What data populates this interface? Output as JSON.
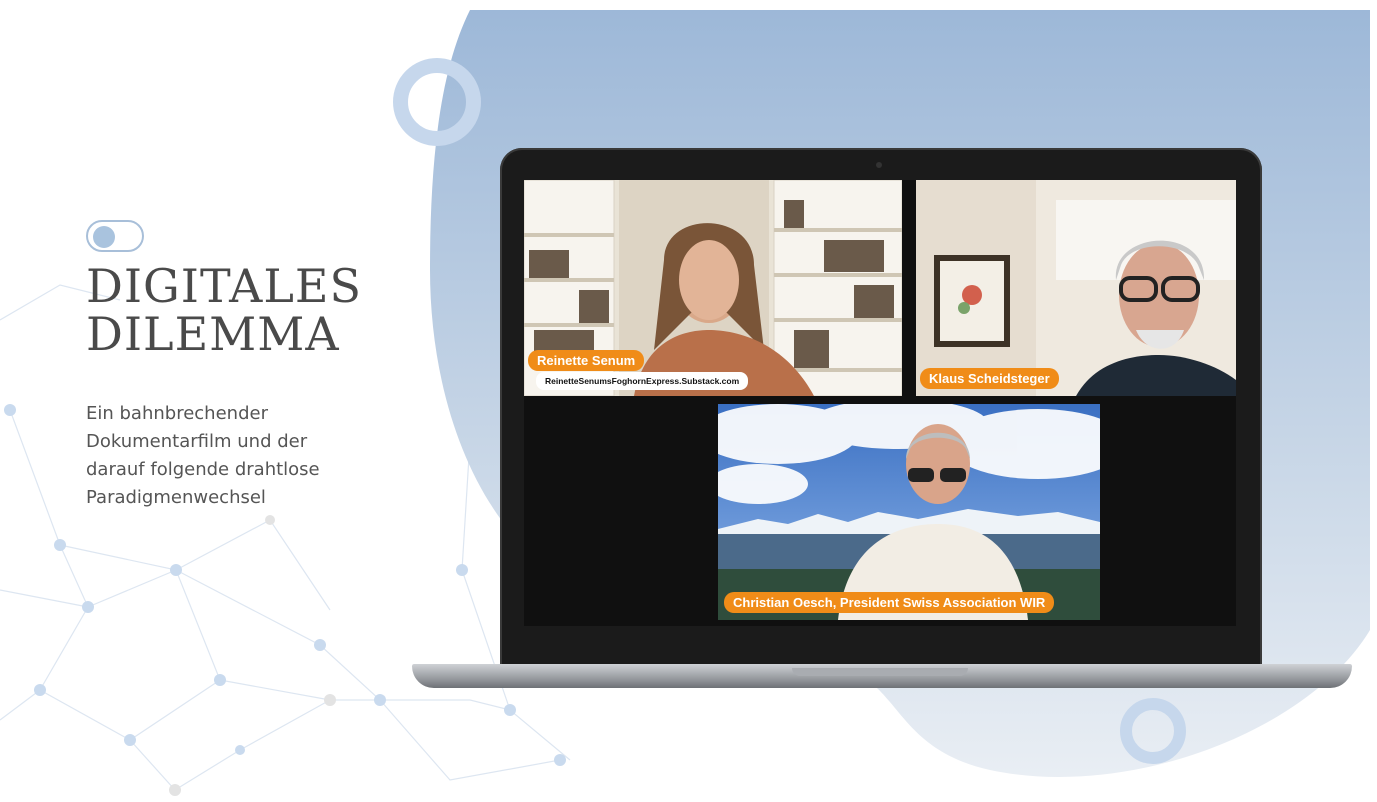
{
  "slide": {
    "title_line1": "DIGITALES",
    "title_line2": "DILEMMA",
    "subtitle_lines": [
      "Ein bahnbrechender",
      "Dokumentarfilm und der",
      "darauf folgende drahtlose",
      "Paradigmenwechsel"
    ]
  },
  "video_call": {
    "participants": [
      {
        "name": "Reinette Senum",
        "url": "ReinetteSenumsFoghornExpress.Substack.com"
      },
      {
        "name": "Klaus Scheidsteger"
      },
      {
        "name": "Christian Oesch, President Swiss Association WIR"
      }
    ]
  },
  "colors": {
    "accent_orange": "#f08c18",
    "ring_blue": "#c6d7ec",
    "title_gray": "#4a4a4a"
  }
}
